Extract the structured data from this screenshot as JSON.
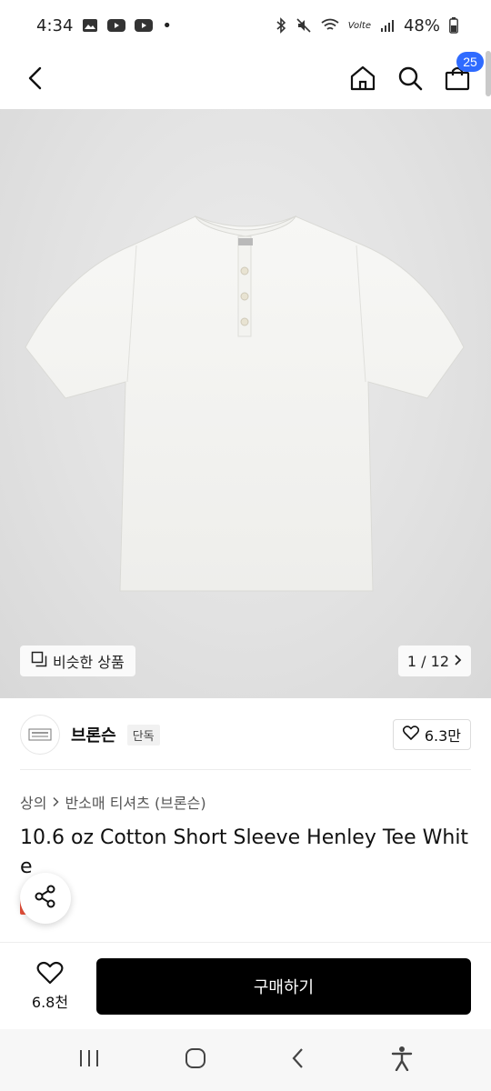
{
  "status_bar": {
    "time": "4:34",
    "dot": "•",
    "signal_text": "Volte",
    "battery": "48%"
  },
  "header": {
    "cart_count": "25"
  },
  "hero": {
    "similar_label": "비슷한 상품",
    "page_indicator": "1 / 12"
  },
  "brand": {
    "name": "브론슨",
    "tag": "단독",
    "likes": "6.3만"
  },
  "product": {
    "breadcrumb_1": "상의",
    "breadcrumb_2": "반소매 티셔츠 (브론슨)",
    "title": "10.6 oz Cotton Short Sleeve Henley Tee White"
  },
  "actions": {
    "wish_count": "6.8천",
    "buy_label": "구매하기"
  },
  "colors": {
    "accent_badge": "#2f6bff",
    "buy_button": "#000000"
  }
}
